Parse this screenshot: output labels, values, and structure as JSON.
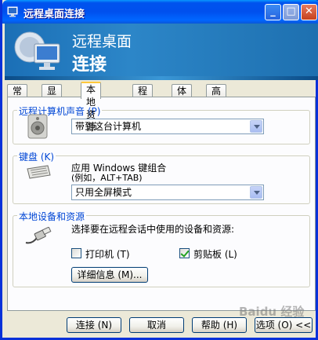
{
  "window": {
    "title": "远程桌面连接"
  },
  "titlebar_buttons": {
    "minimize": "_",
    "maximize": "□",
    "close": "✕"
  },
  "banner": {
    "line1": "远程桌面",
    "line2": "连接"
  },
  "tabs": [
    {
      "label": "常规",
      "active": false
    },
    {
      "label": "显示",
      "active": false
    },
    {
      "label": "本地资源",
      "active": true
    },
    {
      "label": "程序",
      "active": false
    },
    {
      "label": "体验",
      "active": false
    },
    {
      "label": "高级",
      "active": false
    }
  ],
  "sound": {
    "group_label": "远程计算机声音 (P)",
    "selected": "带到这台计算机",
    "icon": "speaker-icon"
  },
  "keyboard": {
    "group_label": "键盘 (K)",
    "description_line1": "应用 Windows 键组合",
    "description_line2": "(例如，ALT+TAB)",
    "selected": "只用全屏模式",
    "icon": "keyboard-icon"
  },
  "devices": {
    "group_label": "本地设备和资源",
    "description": "选择要在远程会话中使用的设备和资源:",
    "printer_label": "打印机 (T)",
    "printer_checked": false,
    "clipboard_label": "剪贴板 (L)",
    "clipboard_checked": true,
    "details_button": "详细信息 (M)...",
    "icon": "usb-plug-icon"
  },
  "footer": {
    "connect": "连接 (N)",
    "cancel": "取消",
    "help": "帮助 (H)",
    "options": "选项 (O) <<"
  },
  "watermark": "Baidu 经验"
}
